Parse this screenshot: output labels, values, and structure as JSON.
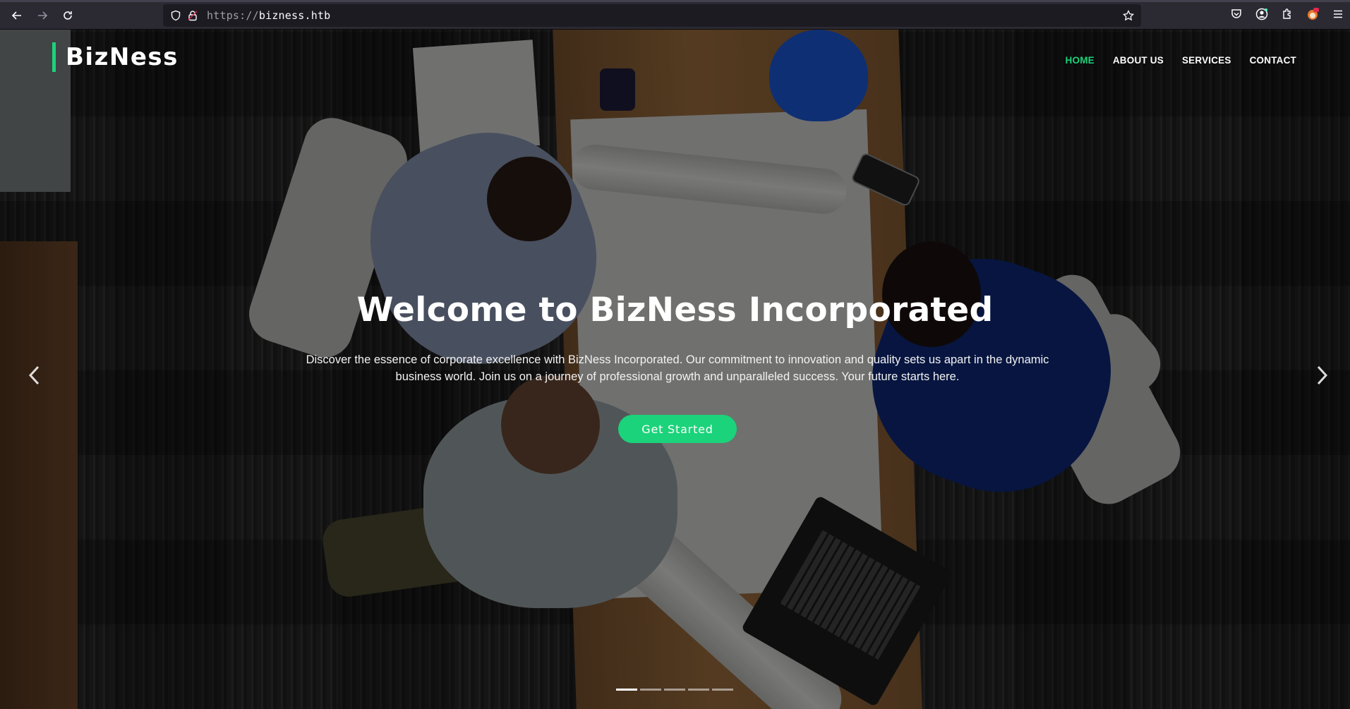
{
  "browser": {
    "url_protocol": "https://",
    "url_host": "bizness.htb"
  },
  "site": {
    "logo": "BizNess",
    "nav": [
      {
        "label": "HOME",
        "active": true
      },
      {
        "label": "ABOUT US",
        "active": false
      },
      {
        "label": "SERVICES",
        "active": false
      },
      {
        "label": "CONTACT",
        "active": false
      }
    ]
  },
  "hero": {
    "title": "Welcome to BizNess Incorporated",
    "text_line1": "Discover the essence of corporate excellence with BizNess Incorporated. Our commitment to innovation and quality sets us apart in the dynamic",
    "text_line2": "business world. Join us on a journey of professional growth and unparalleled success. Your future starts here.",
    "cta": "Get Started",
    "slides": 5,
    "active_slide": 1
  },
  "colors": {
    "accent": "#1bd37a",
    "chrome_bg": "#2b2a33",
    "urlbar_bg": "#1c1b22"
  },
  "icons": [
    "back-icon",
    "forward-icon",
    "reload-icon",
    "shield-icon",
    "lock-icon",
    "star-icon",
    "pocket-icon",
    "account-icon",
    "extensions-icon",
    "fox-extension-icon",
    "menu-icon",
    "chevron-left-icon",
    "chevron-right-icon"
  ]
}
